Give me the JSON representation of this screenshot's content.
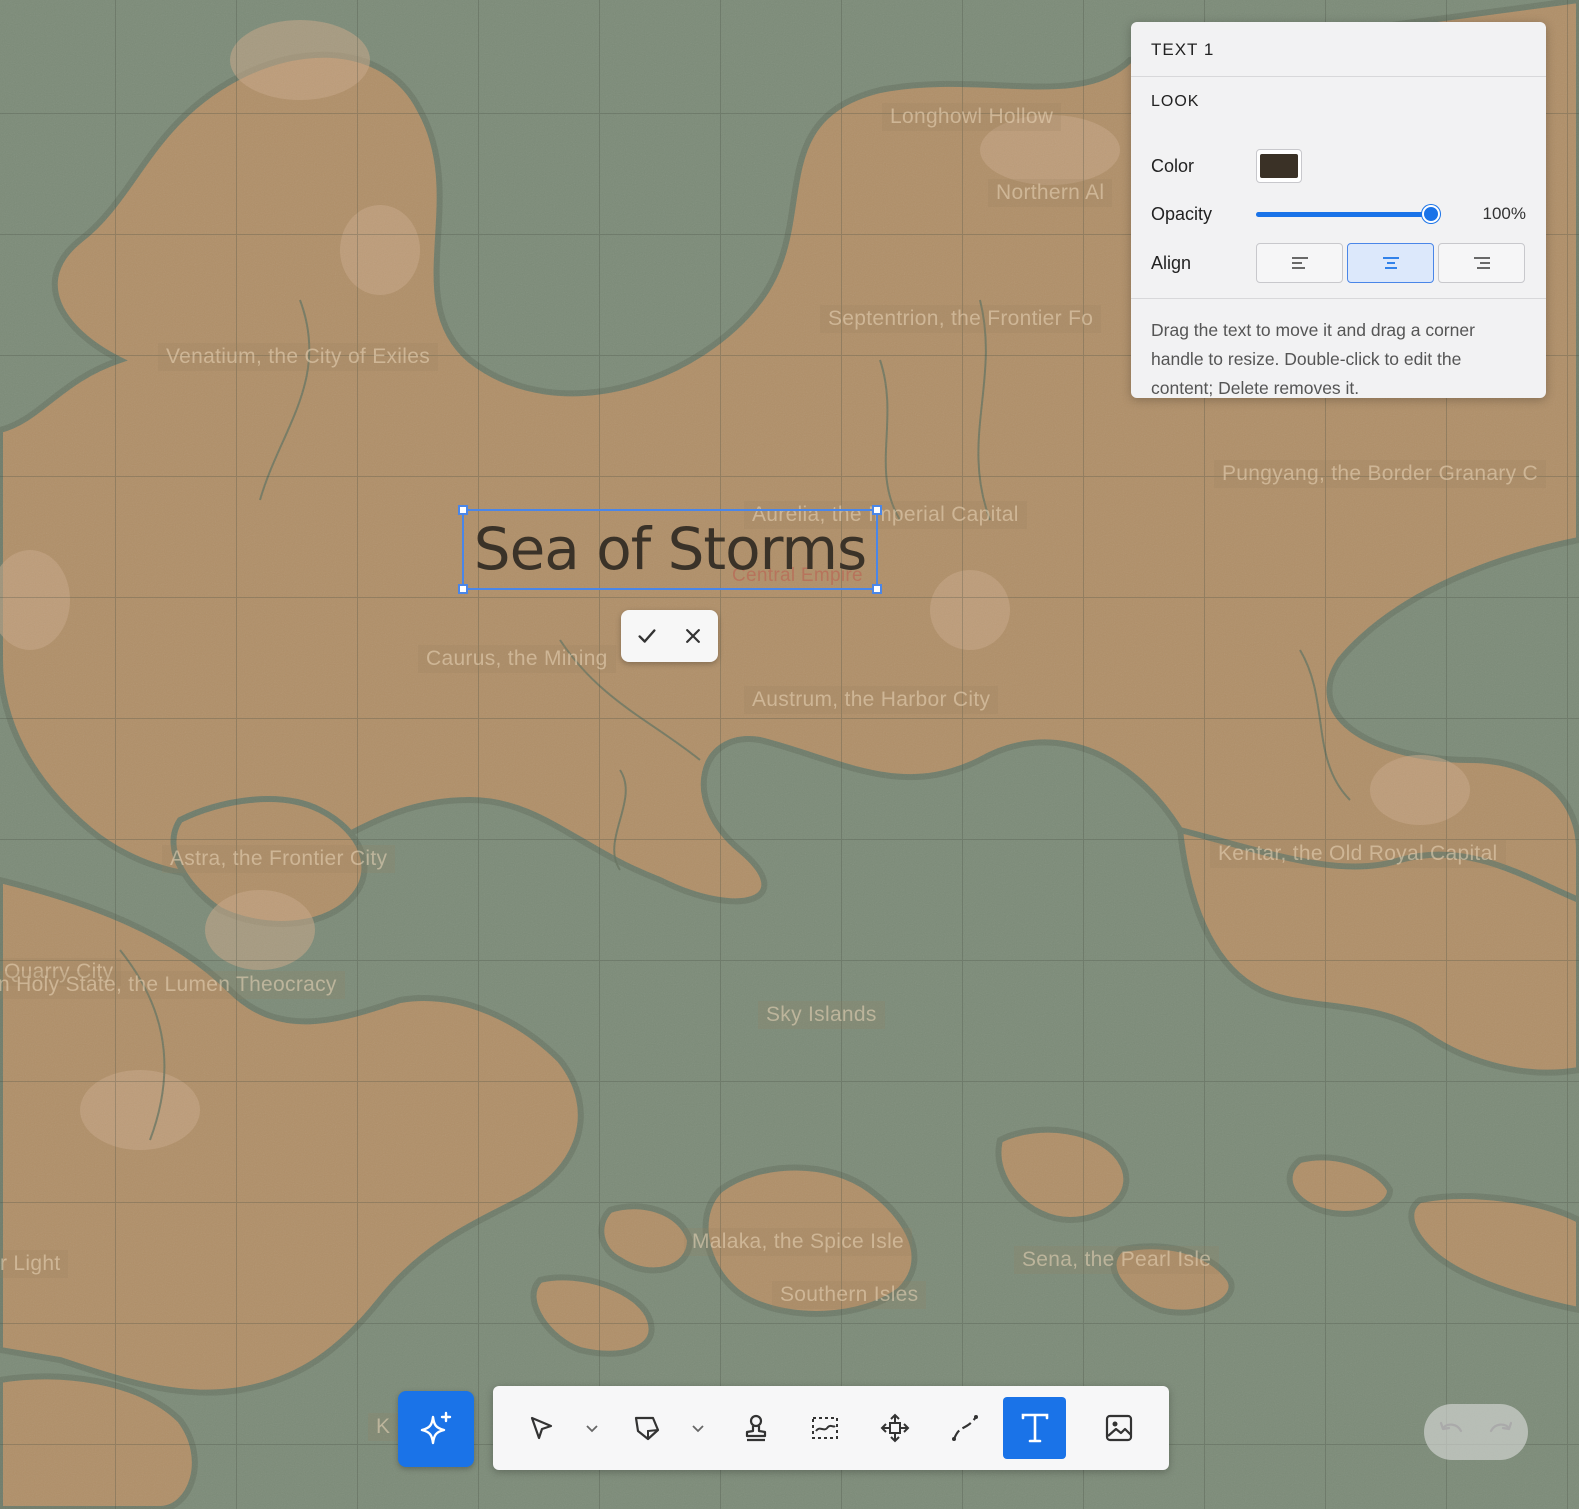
{
  "map": {
    "labels": [
      "Longhowl Hollow",
      "Northern Al",
      "Septentrion, the Frontier Fo",
      "Venatium, the City of Exiles",
      "Pungyang, the Border Granary C",
      "Aurelia, the Imperial Capital",
      "Central Empire",
      "Caurus, the Mining",
      "Austrum, the Harbor City",
      "Astra, the Frontier City",
      "Kentar, the Old Royal Capital",
      "Quarry City",
      "n Holy State, the Lumen Theocracy",
      "Sky Islands",
      "Malaka, the Spice Isle",
      "Sena, the Pearl Isle",
      "Southern Isles",
      "r Light",
      "K"
    ]
  },
  "selected_text": {
    "content": "Sea of Storms",
    "color": "#3a3228"
  },
  "edit_actions": {
    "confirm_icon": "check-icon",
    "cancel_icon": "close-icon"
  },
  "panel": {
    "title": "TEXT 1",
    "section": "LOOK",
    "color_label": "Color",
    "color_value": "#3a3126",
    "opacity_label": "Opacity",
    "opacity_value": "100%",
    "opacity_fraction": 1.0,
    "align_label": "Align",
    "align_options": [
      "left",
      "center",
      "right"
    ],
    "align_selected": "center",
    "help": "Drag the text to move it and drag a corner handle to resize. Double-click to edit the content; Delete removes it."
  },
  "toolbar": {
    "tools": [
      "ai-sparkle",
      "select",
      "select-dropdown",
      "polygon",
      "polygon-dropdown",
      "stamp",
      "region",
      "move",
      "path",
      "text",
      "image"
    ],
    "active_tool": "text",
    "accent_color": "#1a73e8"
  },
  "history": {
    "undo_icon": "undo-icon",
    "redo_icon": "redo-icon"
  }
}
